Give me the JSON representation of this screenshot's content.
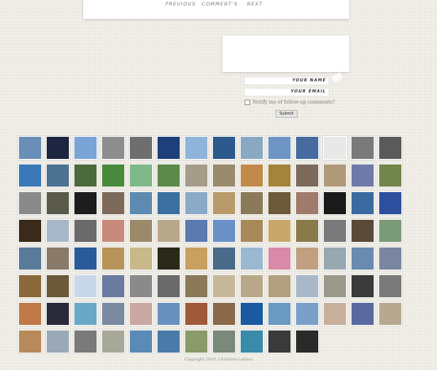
{
  "pager": {
    "previous": "Previous",
    "comments": "Comment's",
    "next": "Next"
  },
  "comment_form": {
    "name_label": "Your name",
    "email_label": "Your email",
    "notify_label": "Notify me of follow-up comments?",
    "submit_label": "Submit"
  },
  "gallery": {
    "columns": 14,
    "thumbs": [
      "#6a8fb7",
      "#1d2540",
      "#7aa4d6",
      "#8d8d8d",
      "#6e6e6e",
      "#1d3f7a",
      "#8fb3d9",
      "#2d5a8c",
      "#89a8c2",
      "#6e95c4",
      "#456b9f",
      "#e8e8e8",
      "#7a7a7a",
      "#5a5a5a",
      "#3a78b8",
      "#4d7291",
      "#4c6a3b",
      "#4a8a3c",
      "#7fb889",
      "#5c8a4a",
      "#a69c8a",
      "#9a8b6d",
      "#c08a4a",
      "#a3843b",
      "#7c6b5a",
      "#b09a7a",
      "#6f7aa8",
      "#72854b",
      "#8a8a8a",
      "#5a5a4a",
      "#1d1d1d",
      "#7d6a5a",
      "#5d8ab0",
      "#3a6f9f",
      "#8aaac8",
      "#b99a6a",
      "#8a7a5a",
      "#6d5a3a",
      "#a07a6a",
      "#1a1a1a",
      "#3a6aa0",
      "#2f4f9f",
      "#3a2a1a",
      "#a8b8c8",
      "#6a6a6a",
      "#c88a7a",
      "#9a8a6a",
      "#b8a88a",
      "#5a7ab0",
      "#6a90c8",
      "#a88a5a",
      "#c8a86a",
      "#8a7a4a",
      "#7a7a7a",
      "#5a4a3a",
      "#7a9a7a",
      "#5a7a9a",
      "#8a7a6a",
      "#2a5a9a",
      "#b8945a",
      "#c8b88a",
      "#2a2a1a",
      "#c8a060",
      "#4a6a8a",
      "#9ab8d0",
      "#d88aa8",
      "#c0a080",
      "#98a8b0",
      "#6a8ab0",
      "#7a86a0",
      "#8a6a3a",
      "#6a5a3a",
      "#c8d8e8",
      "#6a7aa0",
      "#8a8a8a",
      "#6a6a6a",
      "#8a7a5a",
      "#c8b89a",
      "#b8a88a",
      "#b0a080",
      "#a8b8c8",
      "#9a9a8a",
      "#3a3a3a",
      "#7a7a7a",
      "#c07a4a",
      "#2a2a3a",
      "#6aa8c8",
      "#7a8aa0",
      "#c8a8a0",
      "#6a90c0",
      "#a05a3a",
      "#8a6a4a",
      "#1a5aa0",
      "#6a9ac0",
      "#7aa0c8",
      "#c8b09a",
      "#5a6aa0",
      "#b8a890",
      "#b88a5a",
      "#9aa8b8",
      "#7a7a7a",
      "#a8a898",
      "#5a8ab8",
      "#4a7aa8",
      "#8a9a6a",
      "#7a8a7a",
      "#3a8aaa",
      "#3a3a3a",
      "#2a2a2a"
    ]
  },
  "footer": {
    "copyright": "Copyright 2010, Christine Lutters"
  }
}
